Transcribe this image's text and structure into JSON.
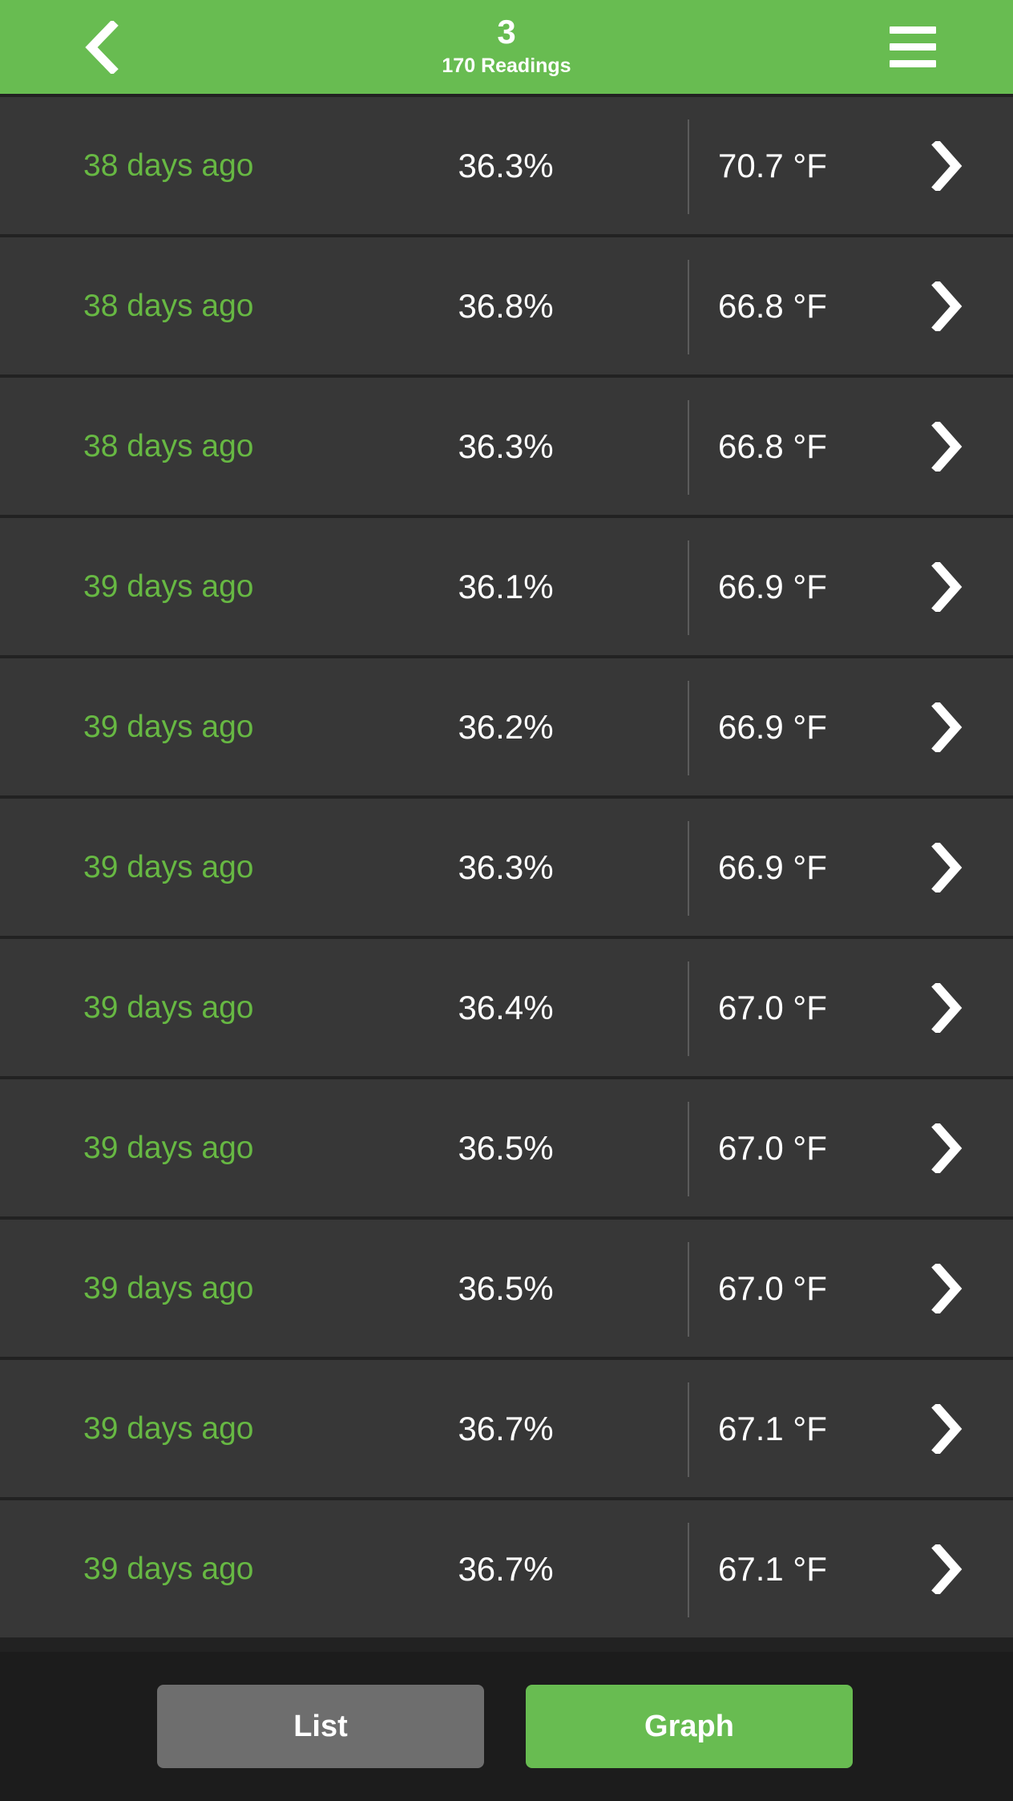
{
  "header": {
    "back_icon": "chevron-left-icon",
    "title": "3",
    "subtitle": "170 Readings",
    "menu_icon": "hamburger-menu-icon"
  },
  "colors": {
    "accent_green": "#68bc51",
    "text_green": "#67b843",
    "row_background": "#373737",
    "page_background": "#222222",
    "bottom_bar_background": "#1c1c1c",
    "inactive_button": "#6e6e6e",
    "divider": "#5b5b5b",
    "text_white": "#ffffff"
  },
  "list": {
    "rows": [
      {
        "date": "38 days ago",
        "humidity": "36.3%",
        "temperature": "70.7 °F",
        "chevron": "chevron-right-icon"
      },
      {
        "date": "38 days ago",
        "humidity": "36.8%",
        "temperature": "66.8 °F",
        "chevron": "chevron-right-icon"
      },
      {
        "date": "38 days ago",
        "humidity": "36.3%",
        "temperature": "66.8 °F",
        "chevron": "chevron-right-icon"
      },
      {
        "date": "39 days ago",
        "humidity": "36.1%",
        "temperature": "66.9 °F",
        "chevron": "chevron-right-icon"
      },
      {
        "date": "39 days ago",
        "humidity": "36.2%",
        "temperature": "66.9 °F",
        "chevron": "chevron-right-icon"
      },
      {
        "date": "39 days ago",
        "humidity": "36.3%",
        "temperature": "66.9 °F",
        "chevron": "chevron-right-icon"
      },
      {
        "date": "39 days ago",
        "humidity": "36.4%",
        "temperature": "67.0 °F",
        "chevron": "chevron-right-icon"
      },
      {
        "date": "39 days ago",
        "humidity": "36.5%",
        "temperature": "67.0 °F",
        "chevron": "chevron-right-icon"
      },
      {
        "date": "39 days ago",
        "humidity": "36.5%",
        "temperature": "67.0 °F",
        "chevron": "chevron-right-icon"
      },
      {
        "date": "39 days ago",
        "humidity": "36.7%",
        "temperature": "67.1 °F",
        "chevron": "chevron-right-icon"
      },
      {
        "date": "39 days ago",
        "humidity": "36.7%",
        "temperature": "67.1 °F",
        "chevron": "chevron-right-icon"
      }
    ]
  },
  "bottom_bar": {
    "list_label": "List",
    "graph_label": "Graph",
    "selected": "Graph"
  }
}
